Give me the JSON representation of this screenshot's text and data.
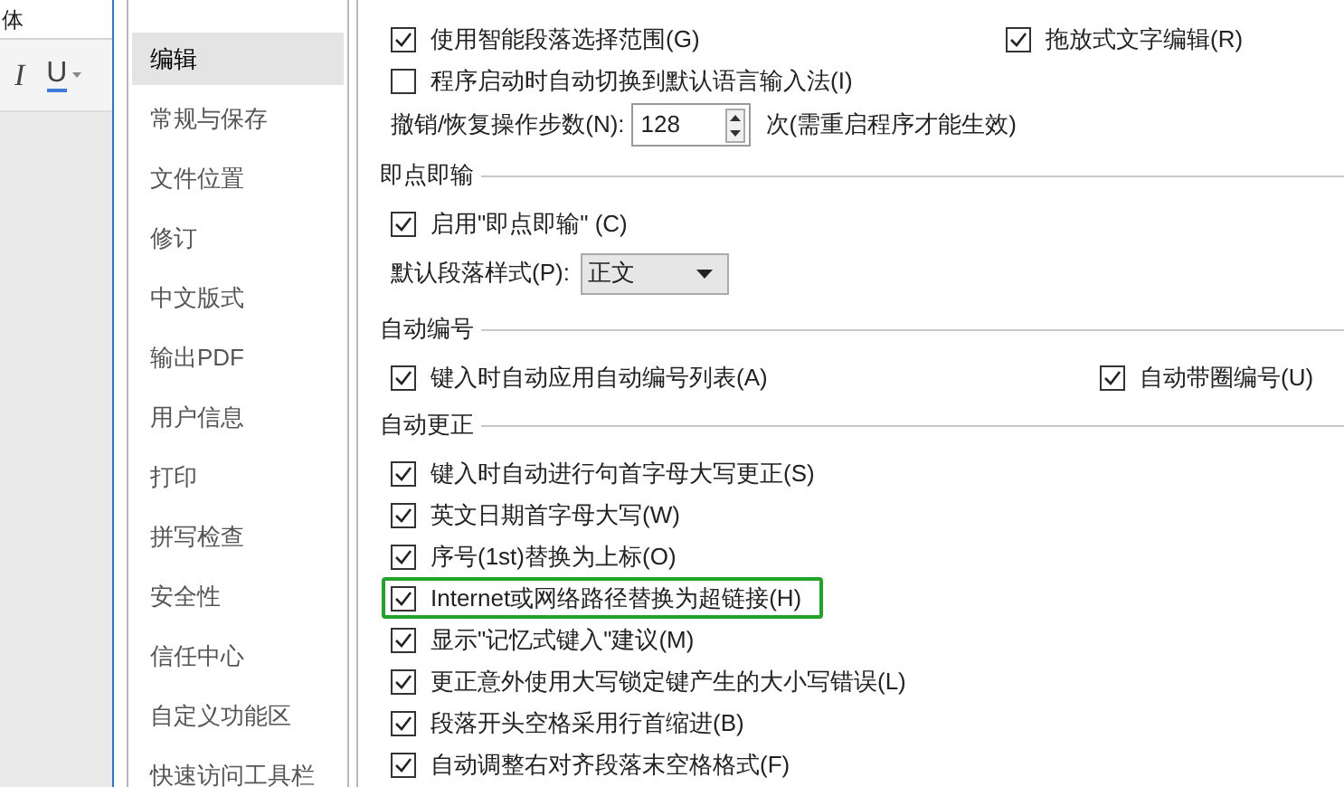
{
  "app": {
    "font_box": "体",
    "toolbar": [
      {
        "kind": "italic",
        "label": "I"
      },
      {
        "kind": "underline",
        "label": "U"
      }
    ]
  },
  "sidebar": {
    "items": [
      {
        "label": "编辑",
        "selected": true
      },
      {
        "label": "常规与保存",
        "selected": false
      },
      {
        "label": "文件位置",
        "selected": false
      },
      {
        "label": "修订",
        "selected": false
      },
      {
        "label": "中文版式",
        "selected": false
      },
      {
        "label": "输出PDF",
        "selected": false
      },
      {
        "label": "用户信息",
        "selected": false
      },
      {
        "label": "打印",
        "selected": false
      },
      {
        "label": "拼写检查",
        "selected": false
      },
      {
        "label": "安全性",
        "selected": false
      },
      {
        "label": "信任中心",
        "selected": false
      },
      {
        "label": "自定义功能区",
        "selected": false
      },
      {
        "label": "快速访问工具栏",
        "selected": false
      }
    ]
  },
  "edit_options": {
    "rows": [
      [
        {
          "label": "使用智能段落选择范围(G)",
          "checked": true
        },
        {
          "label": "拖放式文字编辑(R)",
          "checked": true
        }
      ],
      [
        {
          "label": "程序启动时自动切换到默认语言输入法(I)",
          "checked": false
        }
      ]
    ],
    "undo_steps": {
      "label": "撤销/恢复操作步数(N):",
      "value": "128",
      "note": "次(需重启程序才能生效)"
    }
  },
  "click_and_type": {
    "title": "即点即输",
    "enable": {
      "label": "启用\"即点即输\" (C)",
      "checked": true
    },
    "default_style": {
      "label": "默认段落样式(P):",
      "value": "正文"
    }
  },
  "auto_numbering": {
    "title": "自动编号",
    "items": [
      {
        "label": "键入时自动应用自动编号列表(A)",
        "checked": true
      },
      {
        "label": "自动带圈编号(U)",
        "checked": true
      }
    ]
  },
  "auto_correct": {
    "title": "自动更正",
    "items": [
      {
        "label": "键入时自动进行句首字母大写更正(S)",
        "checked": true,
        "highlighted": false
      },
      {
        "label": "英文日期首字母大写(W)",
        "checked": true,
        "highlighted": false
      },
      {
        "label": "序号(1st)替换为上标(O)",
        "checked": true,
        "highlighted": false
      },
      {
        "label": "Internet或网络路径替换为超链接(H)",
        "checked": true,
        "highlighted": true
      },
      {
        "label": "显示\"记忆式键入\"建议(M)",
        "checked": true,
        "highlighted": false
      },
      {
        "label": "更正意外使用大写锁定键产生的大小写错误(L)",
        "checked": true,
        "highlighted": false
      },
      {
        "label": "段落开头空格采用行首缩进(B)",
        "checked": true,
        "highlighted": false
      },
      {
        "label": "自动调整右对齐段落末空格格式(F)",
        "checked": true,
        "highlighted": false
      }
    ]
  }
}
